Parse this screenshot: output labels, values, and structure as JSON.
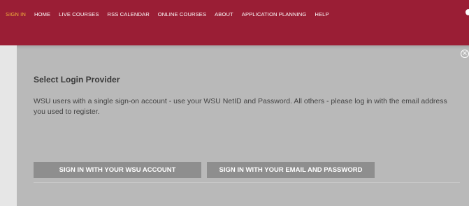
{
  "nav": {
    "items": [
      {
        "label": "Sign In",
        "active": true
      },
      {
        "label": "Home"
      },
      {
        "label": "Live Courses"
      },
      {
        "label": "RSS Calendar"
      },
      {
        "label": "Online Courses"
      },
      {
        "label": "About"
      },
      {
        "label": "Application Planning"
      },
      {
        "label": "Help"
      }
    ]
  },
  "modal": {
    "title": "Select Login Provider",
    "description": "WSU users with a single sign-on account - use your WSU NetID and Password. All others - please log in with the email address you used to register.",
    "buttons": {
      "wsu": "Sign In With Your WSU Account",
      "email": "Sign In With Your Email and Password"
    },
    "close_icon": "close-icon"
  },
  "colors": {
    "nav_background": "#9a1e35",
    "nav_active": "#f2b23c",
    "modal_background": "#b9b9b9",
    "button_background": "#8e8e8e"
  }
}
